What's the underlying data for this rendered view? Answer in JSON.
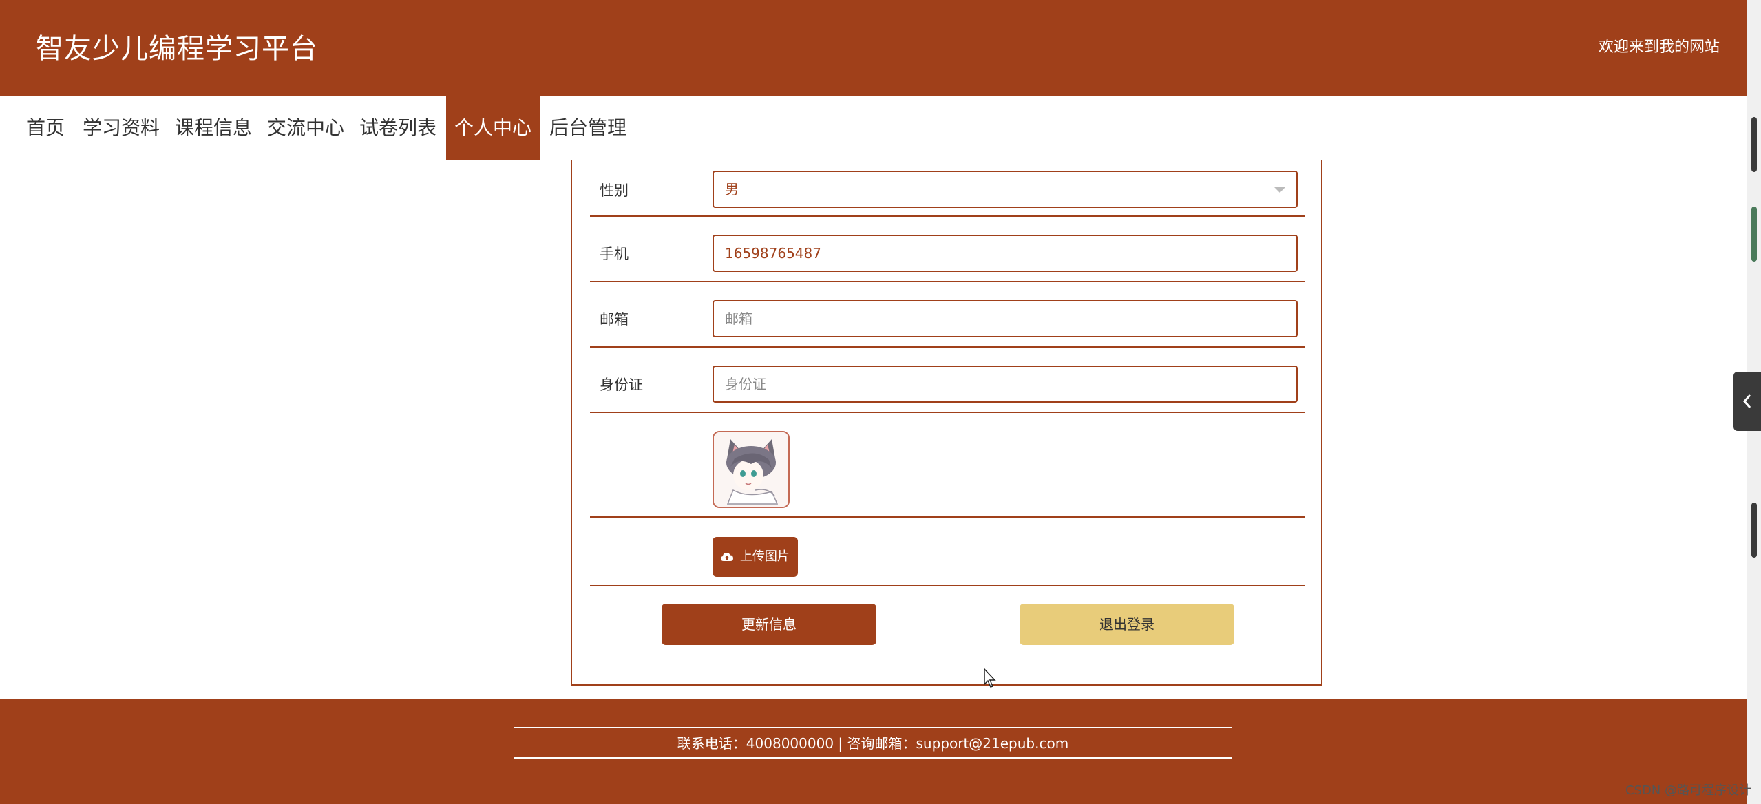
{
  "header": {
    "site_title": "智友少儿编程学习平台",
    "welcome_text": "欢迎来到我的网站"
  },
  "nav": {
    "items": [
      {
        "label": "首页",
        "active": false
      },
      {
        "label": "学习资料",
        "active": false
      },
      {
        "label": "课程信息",
        "active": false
      },
      {
        "label": "交流中心",
        "active": false
      },
      {
        "label": "试卷列表",
        "active": false
      },
      {
        "label": "个人中心",
        "active": true
      },
      {
        "label": "后台管理",
        "active": false
      }
    ]
  },
  "form": {
    "gender": {
      "label": "性别",
      "value": "男"
    },
    "phone": {
      "label": "手机",
      "value": "16598765487"
    },
    "email": {
      "label": "邮箱",
      "placeholder": "邮箱"
    },
    "id_card": {
      "label": "身份证",
      "placeholder": "身份证"
    },
    "upload_label": "上传图片",
    "update_button": "更新信息",
    "logout_button": "退出登录"
  },
  "footer": {
    "contact_text": "联系电话：4008000000 | 咨询邮箱：support@21epub.com"
  },
  "watermark": "CSDN @路可程序设计",
  "colors": {
    "brand": "#a0401a",
    "logout_button": "#e8cc7a"
  },
  "icons": {
    "select_arrow": "chevron-down-icon",
    "upload": "cloud-upload-icon",
    "side_tab": "chevron-left-icon"
  }
}
